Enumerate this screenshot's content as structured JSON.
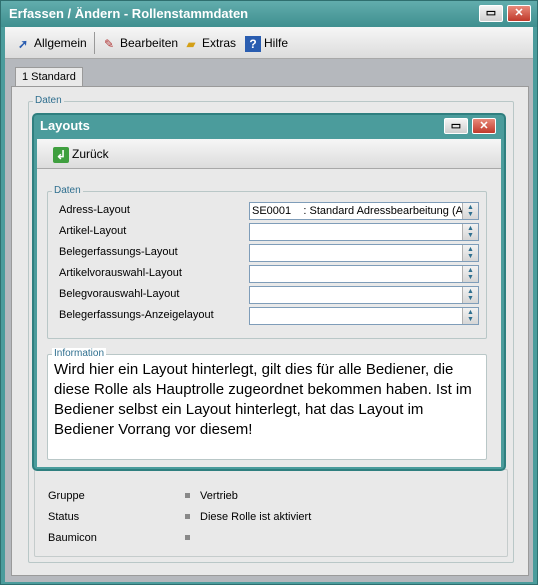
{
  "window": {
    "title": "Erfassen / Ändern - Rollenstammdaten"
  },
  "toolbar": {
    "items": [
      {
        "label": "Allgemein"
      },
      {
        "label": "Bearbeiten"
      },
      {
        "label": "Extras"
      },
      {
        "label": "Hilfe"
      }
    ]
  },
  "tabs": [
    {
      "label": "1 Standard"
    }
  ],
  "main": {
    "daten_legend": "Daten",
    "bottom_rows": [
      {
        "label": "Gruppe",
        "value": "Vertrieb"
      },
      {
        "label": "Status",
        "value": "Diese Rolle ist aktiviert"
      },
      {
        "label": "Baumicon",
        "value": ""
      }
    ]
  },
  "dialog": {
    "title": "Layouts",
    "back_label": "Zurück",
    "daten_legend": "Daten",
    "fields": [
      {
        "label": "Adress-Layout",
        "value": "SE0001    : Standard Adressbearbeitung (A"
      },
      {
        "label": "Artikel-Layout",
        "value": ""
      },
      {
        "label": "Belegerfassungs-Layout",
        "value": ""
      },
      {
        "label": "Artikelvorauswahl-Layout",
        "value": ""
      },
      {
        "label": "Belegvorauswahl-Layout",
        "value": ""
      },
      {
        "label": "Belegerfassungs-Anzeigelayout",
        "value": ""
      }
    ],
    "info_legend": "Information",
    "info_text": "Wird hier ein Layout hinterlegt, gilt dies für alle Bediener, die diese Rolle als Hauptrolle zugeordnet bekommen haben. Ist im Bediener selbst ein Layout hinterlegt, hat das Layout im Bediener Vorrang vor diesem!"
  }
}
